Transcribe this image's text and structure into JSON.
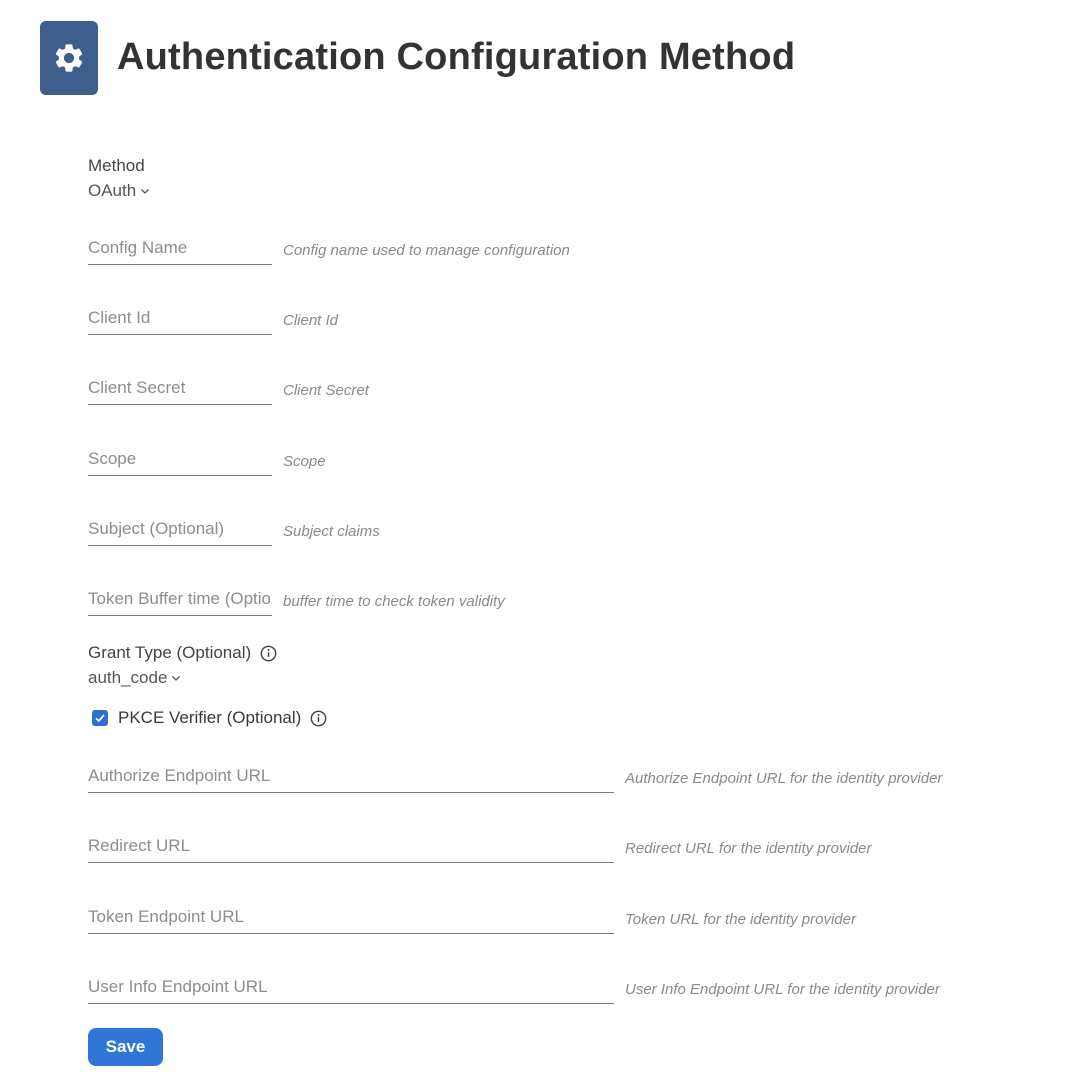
{
  "header": {
    "title": "Authentication Configuration Method",
    "icon": "gear-icon",
    "icon_bg": "#3e5f8e"
  },
  "method": {
    "label": "Method",
    "value": "OAuth"
  },
  "fields_short": [
    {
      "placeholder": "Config Name",
      "hint": "Config name used to manage configuration"
    },
    {
      "placeholder": "Client Id",
      "hint": "Client Id"
    },
    {
      "placeholder": "Client Secret",
      "hint": "Client Secret"
    },
    {
      "placeholder": "Scope",
      "hint": "Scope"
    },
    {
      "placeholder": "Subject (Optional)",
      "hint": "Subject claims"
    },
    {
      "placeholder": "Token Buffer time (Optional)",
      "hint": "buffer time to check token validity"
    }
  ],
  "grant_type": {
    "label": "Grant Type (Optional)",
    "value": "auth_code"
  },
  "pkce": {
    "label": "PKCE Verifier (Optional)",
    "checked": true
  },
  "fields_long": [
    {
      "placeholder": "Authorize Endpoint URL",
      "hint": "Authorize Endpoint URL for the identity provider"
    },
    {
      "placeholder": "Redirect URL",
      "hint": "Redirect URL for the identity provider"
    },
    {
      "placeholder": "Token Endpoint URL",
      "hint": "Token URL for the identity provider"
    },
    {
      "placeholder": "User Info Endpoint URL",
      "hint": "User Info Endpoint URL for the identity provider"
    }
  ],
  "save_label": "Save",
  "colors": {
    "accent": "#2f76d8",
    "checkbox": "#2f6fd0"
  }
}
